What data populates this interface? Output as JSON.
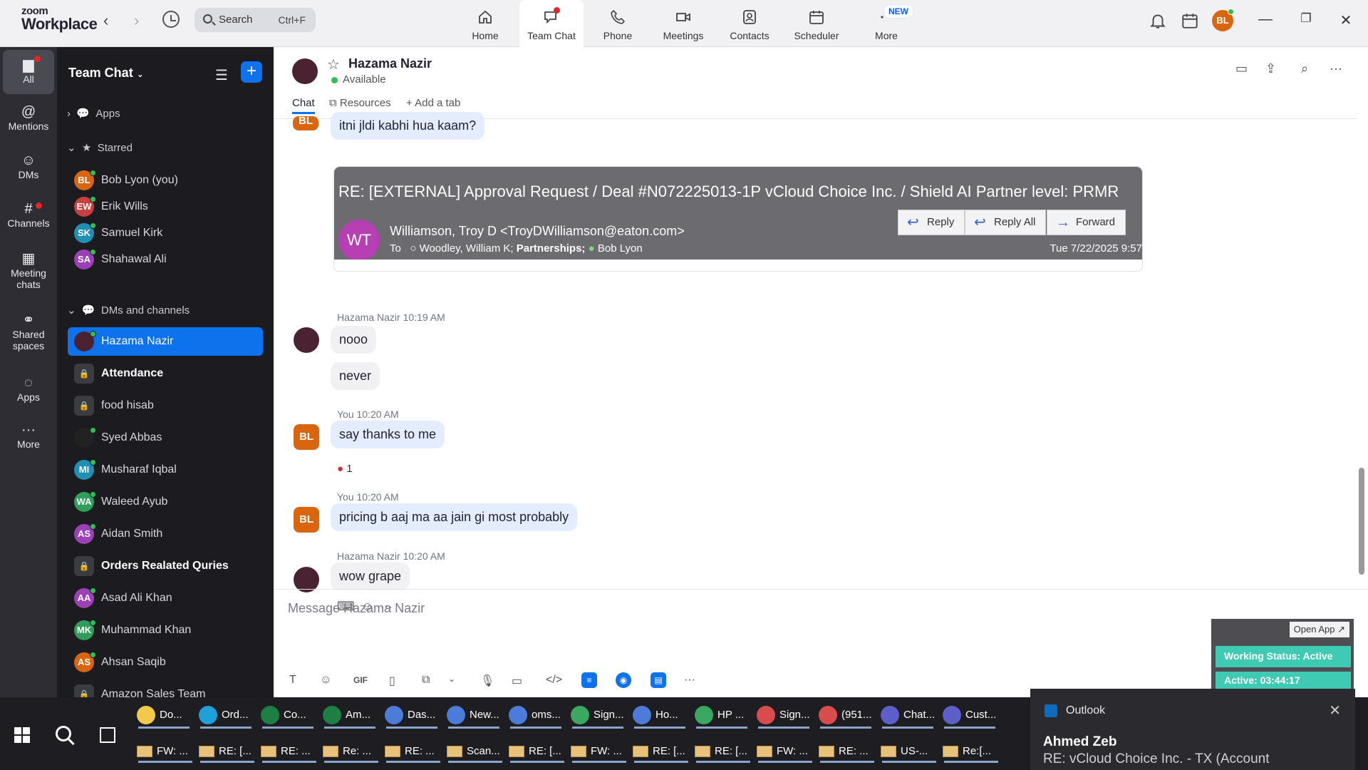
{
  "app": {
    "logo_top": "zoom",
    "logo_bottom": "Workplace",
    "search_label": "Search",
    "search_shortcut": "Ctrl+F",
    "new_badge": "NEW",
    "nav": [
      {
        "label": "Home",
        "icon": "home-icon"
      },
      {
        "label": "Team Chat",
        "icon": "chat-icon"
      },
      {
        "label": "Phone",
        "icon": "phone-icon"
      },
      {
        "label": "Meetings",
        "icon": "video-icon"
      },
      {
        "label": "Contacts",
        "icon": "contacts-icon"
      },
      {
        "label": "Scheduler",
        "icon": "calendar-icon"
      },
      {
        "label": "More",
        "icon": "more-icon"
      }
    ],
    "user_initials": "BL",
    "colors": {
      "accent": "#0e72ed",
      "online": "#2dbf4f",
      "alert": "#e02828"
    }
  },
  "rail": [
    {
      "label": "All",
      "icon": "chat-bubble-icon"
    },
    {
      "label": "Mentions",
      "icon": "at-icon"
    },
    {
      "label": "DMs",
      "icon": "people-icon"
    },
    {
      "label": "Channels",
      "icon": "hash-icon"
    },
    {
      "label": "Meeting chats",
      "icon": "calendar-icon"
    },
    {
      "label": "Shared spaces",
      "icon": "shared-icon"
    },
    {
      "label": "Apps",
      "icon": "apps-icon"
    },
    {
      "label": "More",
      "icon": "ellipsis-icon"
    }
  ],
  "sidebar": {
    "title": "Team Chat",
    "apps_label": "Apps",
    "starred_label": "Starred",
    "starred": [
      {
        "initials": "BL",
        "name": "Bob Lyon (you)",
        "color": "#d9660f"
      },
      {
        "initials": "EW",
        "name": "Erik Wills",
        "color": "#c94040"
      },
      {
        "initials": "SK",
        "name": "Samuel Kirk",
        "color": "#1f8fb5"
      },
      {
        "initials": "SA",
        "name": "Shahawal Ali",
        "color": "#9d3fb5"
      }
    ],
    "dms_label": "DMs and channels",
    "dms": [
      {
        "initials": "",
        "name": "Hazama Nazir",
        "color": "#4a2231",
        "type": "person",
        "bold": false
      },
      {
        "initials": "",
        "name": "Attendance",
        "color": "#3b3b42",
        "type": "lock",
        "bold": true
      },
      {
        "initials": "",
        "name": "food hisab",
        "color": "#3b3b42",
        "type": "lock",
        "bold": false
      },
      {
        "initials": "",
        "name": "Syed Abbas",
        "color": "#222",
        "type": "person",
        "bold": false
      },
      {
        "initials": "MI",
        "name": "Musharaf Iqbal",
        "color": "#1f8fb5",
        "type": "person",
        "bold": false
      },
      {
        "initials": "WA",
        "name": "Waleed Ayub",
        "color": "#2f9e5a",
        "type": "person",
        "bold": false
      },
      {
        "initials": "AS",
        "name": "Aidan Smith",
        "color": "#9d3fb5",
        "type": "person",
        "bold": false
      },
      {
        "initials": "",
        "name": "Orders Realated Quries",
        "color": "#3b3b42",
        "type": "lock",
        "bold": true
      },
      {
        "initials": "AA",
        "name": "Asad Ali Khan",
        "color": "#9d3fb5",
        "type": "person",
        "bold": false
      },
      {
        "initials": "MK",
        "name": "Muhammad Khan",
        "color": "#2f9e5a",
        "type": "person",
        "bold": false
      },
      {
        "initials": "AS",
        "name": "Ahsan Saqib",
        "color": "#d9660f",
        "type": "person",
        "bold": false
      },
      {
        "initials": "",
        "name": "Amazon Sales Team",
        "color": "#3b3b42",
        "type": "lock",
        "bold": false
      }
    ]
  },
  "chat": {
    "contact_name": "Hazama Nazir",
    "status": "Available",
    "tabs": {
      "chat": "Chat",
      "resources": "Resources",
      "add": "Add a tab"
    },
    "first_message": "itni jldi kabhi hua kaam?",
    "email": {
      "subject": "RE: [EXTERNAL] Approval Request / Deal #N072225013-1P vCloud Choice Inc. / Shield AI Partner level: PRMR",
      "initials": "WT",
      "from": "Williamson, Troy D <TroyDWilliamson@eaton.com>",
      "to_label": "To",
      "to_1": "Woodley, William K;",
      "to_2": "Partnerships;",
      "to_3": "Bob Lyon",
      "date": "Tue 7/22/2025 9:57",
      "reply": "Reply",
      "reply_all": "Reply All",
      "forward": "Forward"
    },
    "messages": [
      {
        "sender": "Hazama Nazir",
        "time": "10:19 AM",
        "lines": [
          "nooo",
          "never"
        ]
      },
      {
        "sender": "You",
        "time": "10:20 AM",
        "lines": [
          "say thanks to me"
        ],
        "reaction": "1"
      },
      {
        "sender": "You",
        "time": "10:20 AM",
        "lines": [
          "pricing b aaj ma aa jain gi most probably"
        ]
      },
      {
        "sender": "Hazama Nazir",
        "time": "10:20 AM",
        "lines": [
          "wow grape"
        ]
      }
    ],
    "composer_placeholder": "Message Hazama Nazir",
    "gif_label": "GIF"
  },
  "overlay": {
    "open_app": "Open App ↗",
    "working_status": "Working Status: Active",
    "active_timer": "Active: 03:44:17"
  },
  "taskbar": {
    "apps": [
      {
        "label": "Do...",
        "color": "#f2c94c"
      },
      {
        "label": "Ord...",
        "color": "#1fa0d8"
      },
      {
        "label": "Co...",
        "color": "#1d7f43"
      },
      {
        "label": "Am...",
        "color": "#1d7f43"
      },
      {
        "label": "Das...",
        "color": "#4c7bd9"
      },
      {
        "label": "New...",
        "color": "#4c7bd9"
      },
      {
        "label": "oms...",
        "color": "#4c7bd9"
      },
      {
        "label": "Sign...",
        "color": "#3aa860"
      },
      {
        "label": "Ho...",
        "color": "#4c7bd9"
      },
      {
        "label": "HP ...",
        "color": "#3aa860"
      },
      {
        "label": "Sign...",
        "color": "#d94c4c"
      },
      {
        "label": "(951...",
        "color": "#d94c4c"
      },
      {
        "label": "Chat...",
        "color": "#5b5fc7"
      },
      {
        "label": "Cust...",
        "color": "#5b5fc7"
      }
    ],
    "mails": [
      "FW: ...",
      "RE: [...",
      "RE: ...",
      "Re: ...",
      "RE: ...",
      "Scan...",
      "RE: [...",
      "FW: ...",
      "RE: [...",
      "RE: [...",
      "FW: ...",
      "RE: ...",
      "US-...",
      "Re:[..."
    ],
    "toast_app": "Outlook",
    "toast_name": "Ahmed Zeb",
    "toast_subject": "RE: vCloud Choice Inc. - TX (Account"
  }
}
